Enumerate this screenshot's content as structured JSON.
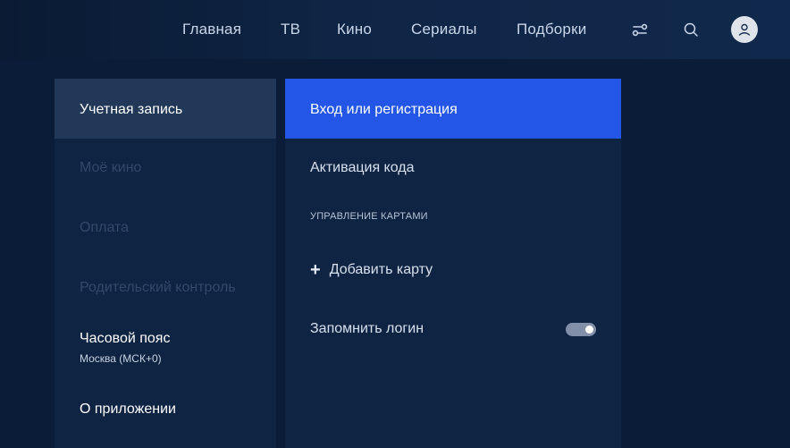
{
  "nav": {
    "items": [
      {
        "label": "Главная"
      },
      {
        "label": "ТВ"
      },
      {
        "label": "Кино"
      },
      {
        "label": "Сериалы"
      },
      {
        "label": "Подборки"
      }
    ],
    "icons": [
      "filters-icon",
      "search-icon",
      "profile-avatar-icon"
    ]
  },
  "left_menu": {
    "items": [
      {
        "label": "Учетная запись",
        "state": "selected"
      },
      {
        "label": "Моё кино",
        "state": "disabled"
      },
      {
        "label": "Оплата",
        "state": "disabled"
      },
      {
        "label": "Родительский контроль",
        "state": "disabled"
      },
      {
        "label": "Часовой пояс",
        "sub": "Москва (МСК+0)",
        "state": "normal"
      },
      {
        "label": "О приложении",
        "state": "normal"
      }
    ]
  },
  "right_panel": {
    "login_label": "Вход или регистрация",
    "activation_label": "Активация кода",
    "cards_section_header": "УПРАВЛЕНИЕ КАРТАМИ",
    "add_card_label": "Добавить карту",
    "remember_login_label": "Запомнить логин",
    "remember_login_on": true
  },
  "colors": {
    "background": "#0b1c38",
    "panel": "#0f2342",
    "selected_left": "#213859",
    "accent_blue": "#2356e6"
  }
}
